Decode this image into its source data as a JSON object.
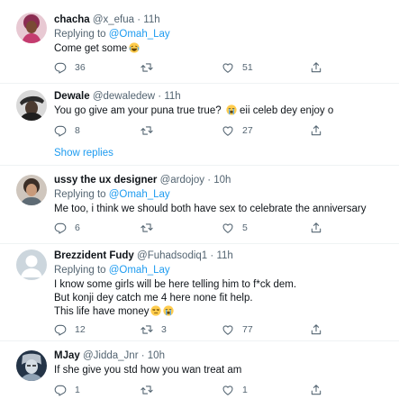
{
  "tweets": [
    {
      "name": "chacha",
      "handle": "@x_efua",
      "dot": "·",
      "time": "11h",
      "replying_prefix": "Replying to ",
      "replying_to": "@Omah_Lay",
      "text_lines": [
        "Come get some"
      ],
      "emoji": [
        "laughing-crying"
      ],
      "replies": "36",
      "retweets": "",
      "likes": "51"
    },
    {
      "name": "Dewale",
      "handle": "@dewaledew",
      "dot": "·",
      "time": "11h",
      "text_lines": [
        "You go give am your puna true true?",
        "eii celeb dey enjoy o"
      ],
      "emoji": [
        "loudly-crying"
      ],
      "replies": "8",
      "retweets": "",
      "likes": "27",
      "show_replies": "Show replies"
    },
    {
      "name": "ussy the ux designer",
      "handle": "@ardojoy",
      "dot": "·",
      "time": "10h",
      "replying_prefix": "Replying to ",
      "replying_to": "@Omah_Lay",
      "text_lines": [
        "Me too,  i think we should both have sex to celebrate the anniversary"
      ],
      "replies": "6",
      "retweets": "",
      "likes": "5"
    },
    {
      "name": "Brezzident Fudy",
      "handle": "@Fuhadsodiq1",
      "dot": "·",
      "time": "11h",
      "replying_prefix": "Replying to ",
      "replying_to": "@Omah_Lay",
      "text_lines": [
        "I know some girls will be here telling him to f*ck dem.",
        "But konji dey catch me 4 here none fit help.",
        "This life have money"
      ],
      "emoji": [
        "unamused",
        "loudly-crying"
      ],
      "replies": "12",
      "retweets": "3",
      "likes": "77"
    },
    {
      "name": "MJay",
      "handle": "@Jidda_Jnr",
      "dot": "·",
      "time": "10h",
      "text_lines": [
        "If she give you std how you wan treat am"
      ],
      "replies": "1",
      "retweets": "",
      "likes": "1"
    }
  ],
  "colors": {
    "accent": "#1d9bf0",
    "muted": "#536471",
    "divider": "#eff3f4"
  },
  "icons": [
    "reply-icon",
    "retweet-icon",
    "like-icon",
    "share-icon"
  ]
}
